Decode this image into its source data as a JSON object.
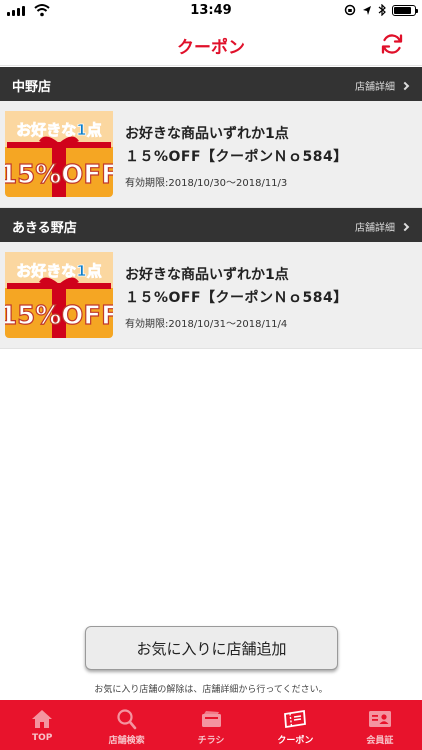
{
  "status_bar": {
    "time": "13:49",
    "battery_level": 0.85
  },
  "nav": {
    "title": "クーポン",
    "refresh_icon": "refresh-icon"
  },
  "stores": [
    {
      "name": "中野店",
      "link_label": "店舗詳細",
      "coupon": {
        "image_text_top": "お好きな1点",
        "image_text_bottom": "15%OFF",
        "title": "お好きな商品いずれか1点",
        "subtitle": "１５%OFF【クーポンＮｏ584】",
        "period": "有効期限:2018/10/30〜2018/11/3"
      }
    },
    {
      "name": "あきる野店",
      "link_label": "店舗詳細",
      "coupon": {
        "image_text_top": "お好きな1点",
        "image_text_bottom": "15%OFF",
        "title": "お好きな商品いずれか1点",
        "subtitle": "１５%OFF【クーポンＮｏ584】",
        "period": "有効期限:2018/10/31〜2018/11/4"
      }
    }
  ],
  "add_store_button": "お気に入りに店舗追加",
  "footer_note": "お気に入り店舗の解除は、店舗詳細から行ってください。",
  "tabs": [
    {
      "label": "TOP",
      "icon": "home-icon"
    },
    {
      "label": "店舗検索",
      "icon": "search-icon"
    },
    {
      "label": "チラシ",
      "icon": "flyer-icon"
    },
    {
      "label": "クーポン",
      "icon": "coupon-icon"
    },
    {
      "label": "会員証",
      "icon": "member-card-icon"
    }
  ],
  "colors": {
    "accent": "#e0102a",
    "tab_bar": "#e8132c",
    "store_header": "#333333"
  }
}
